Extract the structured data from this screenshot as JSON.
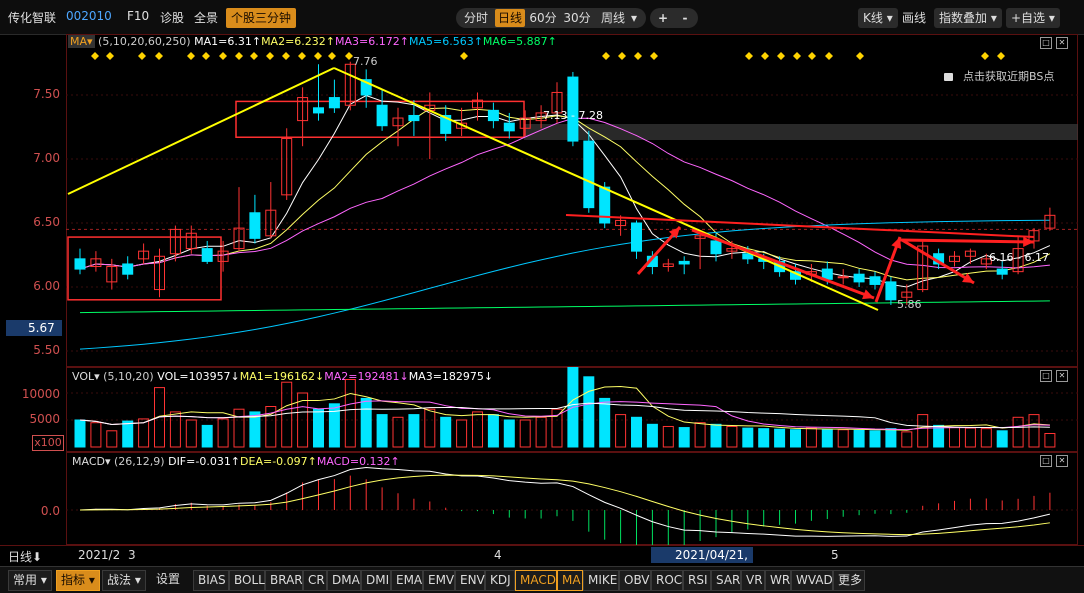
{
  "header": {
    "stock_name": "传化智联",
    "stock_code": "002010",
    "f10": "F10",
    "diagnose": "诊股",
    "full_screen": "全景",
    "timeshare": "个股三分钟",
    "periods": [
      "分时",
      "日线",
      "60分",
      "30分",
      "周线"
    ],
    "active_period": "日线",
    "plus": "+",
    "minus": "-",
    "kline": "K线",
    "draw": "画线",
    "indicator_overlay": "指数叠加",
    "add_watch": "+自选"
  },
  "main_panel": {
    "indicator_button": "MA",
    "params": "(5,10,20,60,250)",
    "ma1": "MA1=6.31↑",
    "ma2": "MA2=6.232↑",
    "ma3": "MA3=6.172↑",
    "ma5": "MA5=6.563↑",
    "ma6": "MA6=5.887↑",
    "lock_text": "点击获取近期BS点",
    "price_label": "5.67",
    "y_ticks": [
      "7.50",
      "7.00",
      "6.50",
      "6.00",
      "5.50"
    ],
    "annot_high": "7.76",
    "annot_range1": "7.13 - 7.28",
    "annot_range2": "6.16 - 6.17",
    "annot_low": "5.86",
    "colors": {
      "up": "#ff3333",
      "down": "#00e5ff",
      "ma1": "#ffffff",
      "ma2": "#ffff66",
      "ma3": "#ff66ff",
      "ma5": "#00c8ff",
      "ma6": "#00ff66",
      "trend": "#ffff00",
      "arrow": "#ff2020",
      "box": "#ff3030"
    }
  },
  "vol_panel": {
    "label": "VOL",
    "params": "(5,10,20)",
    "vol": "VOL=103957↓",
    "ma1": "MA1=196162↓",
    "ma2": "MA2=192481↓",
    "ma3": "MA3=182975↓",
    "y_ticks": [
      "10000",
      "5000"
    ],
    "unit": "x100"
  },
  "macd_panel": {
    "label": "MACD",
    "params": "(26,12,9)",
    "dif": "DIF=-0.031↑",
    "dea": "DEA=-0.097↑",
    "macd": "MACD=0.132↑",
    "y_tick": "0.0"
  },
  "date_axis": {
    "period_label": "日线",
    "labels": [
      "2021/2",
      "3",
      "4",
      "2021/04/21,—",
      "5"
    ]
  },
  "bottom_bar": {
    "common": "常用",
    "indicator": "指标",
    "strategy": "战法",
    "settings": "设置",
    "tabs": [
      "BIAS",
      "BOLL",
      "BRAR",
      "CR",
      "DMA",
      "DMI",
      "EMA",
      "EMV",
      "ENV",
      "KDJ",
      "MACD",
      "MA",
      "MIKE",
      "OBV",
      "ROC",
      "RSI",
      "SAR",
      "VR",
      "WR",
      "WVAD",
      "更多"
    ],
    "active_tabs": [
      "MACD",
      "MA"
    ]
  },
  "candles": [
    [
      6.22,
      6.14,
      6.3,
      6.1
    ],
    [
      6.16,
      6.22,
      6.28,
      6.12
    ],
    [
      6.04,
      6.16,
      6.22,
      5.98
    ],
    [
      6.18,
      6.1,
      6.24,
      6.06
    ],
    [
      6.22,
      6.28,
      6.34,
      6.18
    ],
    [
      5.98,
      6.24,
      6.3,
      5.92
    ],
    [
      6.26,
      6.45,
      6.48,
      6.2
    ],
    [
      6.3,
      6.42,
      6.48,
      6.26
    ],
    [
      6.3,
      6.2,
      6.36,
      6.18
    ],
    [
      6.2,
      6.28,
      6.36,
      6.12
    ],
    [
      6.3,
      6.46,
      6.78,
      6.28
    ],
    [
      6.58,
      6.38,
      6.72,
      6.34
    ],
    [
      6.4,
      6.6,
      6.82,
      6.38
    ],
    [
      6.72,
      7.16,
      7.24,
      6.68
    ],
    [
      7.3,
      7.48,
      7.56,
      7.1
    ],
    [
      7.4,
      7.36,
      7.74,
      7.3
    ],
    [
      7.48,
      7.4,
      7.62,
      7.36
    ],
    [
      7.42,
      7.74,
      7.76,
      7.38
    ],
    [
      7.62,
      7.5,
      7.7,
      7.4
    ],
    [
      7.42,
      7.26,
      7.54,
      7.22
    ],
    [
      7.26,
      7.32,
      7.4,
      7.1
    ],
    [
      7.34,
      7.3,
      7.46,
      7.18
    ],
    [
      7.38,
      7.42,
      7.52,
      7.0
    ],
    [
      7.34,
      7.2,
      7.42,
      7.14
    ],
    [
      7.24,
      7.28,
      7.4,
      7.18
    ],
    [
      7.4,
      7.46,
      7.52,
      7.3
    ],
    [
      7.38,
      7.3,
      7.44,
      7.24
    ],
    [
      7.28,
      7.22,
      7.36,
      7.16
    ],
    [
      7.24,
      7.32,
      7.38,
      7.18
    ],
    [
      7.3,
      7.36,
      7.42,
      7.24
    ],
    [
      7.36,
      7.52,
      7.6,
      7.28
    ],
    [
      7.64,
      7.14,
      7.68,
      7.1
    ],
    [
      7.14,
      6.62,
      7.22,
      6.58
    ],
    [
      6.78,
      6.5,
      6.82,
      6.46
    ],
    [
      6.48,
      6.52,
      6.56,
      6.4
    ],
    [
      6.5,
      6.28,
      6.52,
      6.22
    ],
    [
      6.24,
      6.16,
      6.28,
      6.1
    ],
    [
      6.16,
      6.18,
      6.22,
      6.12
    ],
    [
      6.2,
      6.18,
      6.24,
      6.1
    ],
    [
      6.38,
      6.4,
      6.44,
      6.14
    ],
    [
      6.36,
      6.26,
      6.42,
      6.2
    ],
    [
      6.28,
      6.3,
      6.36,
      6.22
    ],
    [
      6.26,
      6.22,
      6.32,
      6.18
    ],
    [
      6.22,
      6.2,
      6.26,
      6.14
    ],
    [
      6.2,
      6.12,
      6.24,
      6.08
    ],
    [
      6.12,
      6.06,
      6.18,
      6.02
    ],
    [
      6.1,
      6.12,
      6.18,
      6.04
    ],
    [
      6.14,
      6.06,
      6.2,
      6.02
    ],
    [
      6.08,
      6.08,
      6.14,
      6.02
    ],
    [
      6.1,
      6.04,
      6.14,
      6.0
    ],
    [
      6.08,
      6.02,
      6.12,
      5.98
    ],
    [
      6.04,
      5.9,
      6.08,
      5.86
    ],
    [
      5.92,
      5.96,
      6.02,
      5.86
    ],
    [
      5.98,
      6.32,
      6.36,
      5.96
    ],
    [
      6.26,
      6.18,
      6.3,
      6.14
    ],
    [
      6.2,
      6.24,
      6.28,
      6.16
    ],
    [
      6.24,
      6.28,
      6.3,
      6.18
    ],
    [
      6.18,
      6.22,
      6.26,
      6.14
    ],
    [
      6.14,
      6.1,
      6.2,
      6.06
    ],
    [
      6.12,
      6.3,
      6.4,
      6.1
    ],
    [
      6.36,
      6.44,
      6.46,
      6.3
    ],
    [
      6.46,
      6.56,
      6.62,
      6.44
    ]
  ],
  "volumes": [
    5000,
    4500,
    3000,
    4800,
    5200,
    11000,
    6500,
    5000,
    4000,
    5200,
    7000,
    6500,
    7500,
    12000,
    10000,
    7000,
    8000,
    12500,
    9000,
    6000,
    5500,
    6000,
    7000,
    5500,
    5000,
    6500,
    6000,
    5000,
    5000,
    5500,
    7000,
    21000,
    13000,
    9000,
    6000,
    5500,
    4200,
    3800,
    3600,
    4500,
    4200,
    3800,
    3500,
    3400,
    3300,
    3200,
    3500,
    3300,
    3200,
    3100,
    3000,
    3400,
    2800,
    6000,
    4000,
    3600,
    3500,
    3400,
    3000,
    5500,
    6000,
    2500
  ]
}
